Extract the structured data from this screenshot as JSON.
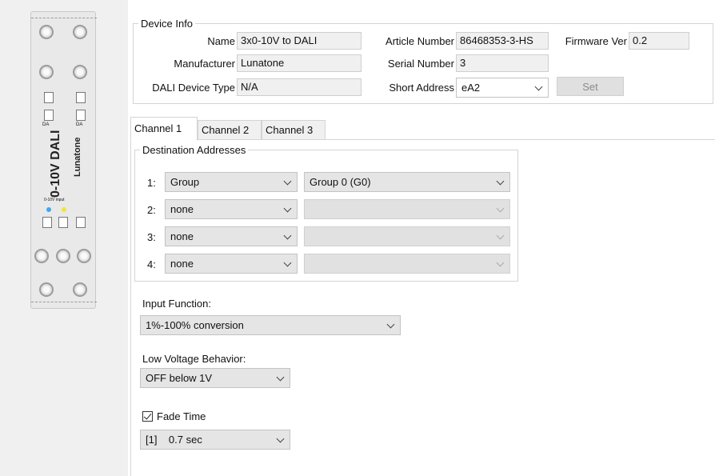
{
  "device_image": {
    "brand": "Lunatone",
    "model_text": "0-10V DALI",
    "small_text": "0-10V input",
    "terminal_labels": [
      "DA",
      "DA"
    ],
    "led_colors": [
      "#3aa9f0",
      "#f0e63a"
    ]
  },
  "device_info": {
    "legend": "Device Info",
    "name_label": "Name",
    "name_value": "3x0-10V to DALI",
    "manufacturer_label": "Manufacturer",
    "manufacturer_value": "Lunatone",
    "dali_type_label": "DALI Device Type",
    "dali_type_value": "N/A",
    "article_label": "Article Number",
    "article_value": "86468353-3-HS",
    "serial_label": "Serial Number",
    "serial_value": "3",
    "short_address_label": "Short Address",
    "short_address_value": "eA2",
    "firmware_label": "Firmware Ver",
    "firmware_value": "0.2",
    "set_label": "Set"
  },
  "tabs": [
    {
      "label": "Channel 1",
      "active": true
    },
    {
      "label": "Channel 2",
      "active": false
    },
    {
      "label": "Channel 3",
      "active": false
    }
  ],
  "destinations": {
    "legend": "Destination Addresses",
    "rows": [
      {
        "num": "1:",
        "type": "Group",
        "target": "Group 0 (G0)"
      },
      {
        "num": "2:",
        "type": "none",
        "target": ""
      },
      {
        "num": "3:",
        "type": "none",
        "target": ""
      },
      {
        "num": "4:",
        "type": "none",
        "target": ""
      }
    ]
  },
  "input_function": {
    "label": "Input Function:",
    "value": "1%-100% conversion"
  },
  "low_voltage": {
    "label": "Low Voltage Behavior:",
    "value": "OFF below 1V"
  },
  "fade_time": {
    "label": "Fade Time",
    "checked": true,
    "value": "[1]    0.7 sec"
  }
}
